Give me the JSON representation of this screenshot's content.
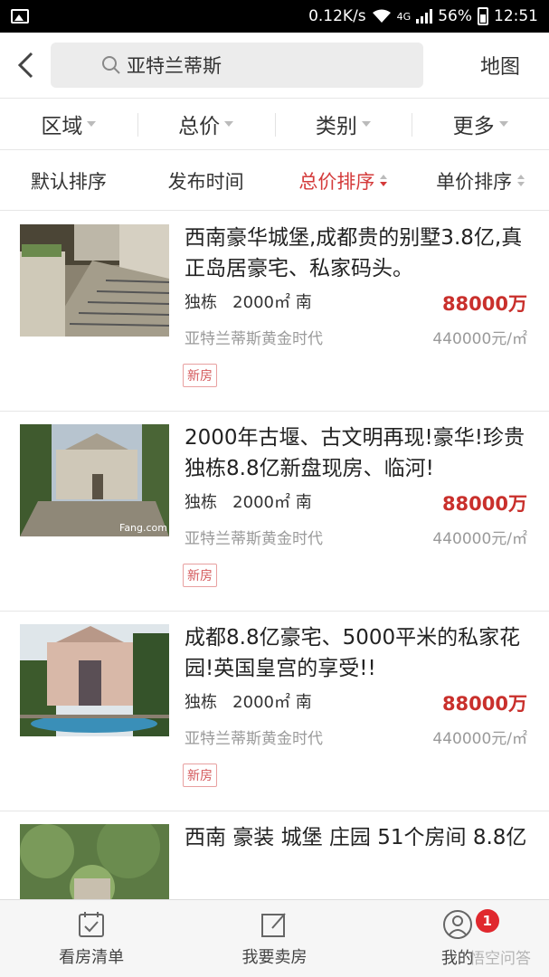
{
  "status_bar": {
    "speed": "0.12K/s",
    "network": "4G",
    "battery": "56%",
    "time": "12:51"
  },
  "header": {
    "search_text": "亚特兰蒂斯",
    "map_label": "地图"
  },
  "filters": [
    "区域",
    "总价",
    "类别",
    "更多"
  ],
  "sorts": [
    {
      "label": "默认排序",
      "active": false
    },
    {
      "label": "发布时间",
      "active": false
    },
    {
      "label": "总价排序",
      "active": true
    },
    {
      "label": "单价排序",
      "active": false
    }
  ],
  "listings": [
    {
      "title": "西南豪华城堡,成都贵的别墅3.8亿,真正岛居豪宅、私家码头。",
      "type": "独栋",
      "area": "2000㎡",
      "orientation": "南",
      "price": "88000万",
      "location": "亚特兰蒂斯黄金时代",
      "unit_price": "440000元/㎡",
      "tag": "新房"
    },
    {
      "title": "2000年古堰、古文明再现!豪华!珍贵独栋8.8亿新盘现房、临河!",
      "type": "独栋",
      "area": "2000㎡",
      "orientation": "南",
      "price": "88000万",
      "location": "亚特兰蒂斯黄金时代",
      "unit_price": "440000元/㎡",
      "tag": "新房",
      "photo_watermark": "Fang.com"
    },
    {
      "title": "成都8.8亿豪宅、5000平米的私家花园!英国皇宫的享受!!",
      "type": "独栋",
      "area": "2000㎡",
      "orientation": "南",
      "price": "88000万",
      "location": "亚特兰蒂斯黄金时代",
      "unit_price": "440000元/㎡",
      "tag": "新房"
    },
    {
      "title": "西南 豪装 城堡 庄园 51个房间 8.8亿"
    }
  ],
  "bottom_nav": [
    {
      "label": "看房清单",
      "icon": "calendar-check-icon"
    },
    {
      "label": "我要卖房",
      "icon": "edit-icon"
    },
    {
      "label": "我的",
      "icon": "user-icon",
      "badge": "1"
    }
  ],
  "watermark": "悟空问答"
}
